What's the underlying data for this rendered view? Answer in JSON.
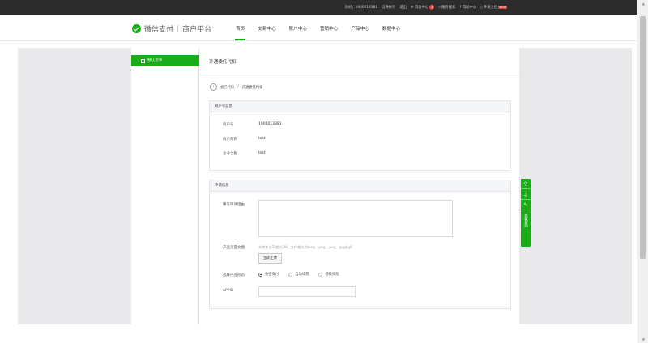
{
  "topbar": {
    "greeting": "你好，1900013381",
    "switch_account": "切换帐号",
    "logout": "退出",
    "message_center": "消息中心",
    "message_count": "2",
    "service_search": "服务搜索",
    "help_center": "帮助中心",
    "dev_docs": "开发文档",
    "new_tag": "NEW"
  },
  "header": {
    "logo_text": "微信支付",
    "platform_text": "商户平台",
    "nav": [
      "首页",
      "交易中心",
      "账户中心",
      "营销中心",
      "产品中心",
      "数据中心"
    ],
    "active_index": 0
  },
  "sidebar": {
    "active_item": "默认菜单"
  },
  "content": {
    "title": "开通委托代扣",
    "breadcrumb_parent": "委托代扣",
    "breadcrumb_sep": "/",
    "breadcrumb_current": "开通委托代扣"
  },
  "merchant_section": {
    "header": "商户号信息",
    "fields": [
      {
        "label": "商户号",
        "value": "1900013381"
      },
      {
        "label": "商户简称",
        "value": "test"
      },
      {
        "label": "企业全称",
        "value": "test"
      }
    ]
  },
  "apply_section": {
    "header": "申请信息",
    "reason_label": "填写申请理由",
    "screenshot_label": "产品页面文图",
    "upload_hint": "文件大小不超过2M，文件格式为bmp、png、jpeg、jpg或gif",
    "upload_button": "立即上传",
    "product_type_label": "选择产品形态",
    "product_types": [
      "免密支付",
      "自动续费",
      "授权扣款"
    ],
    "selected_product_type": "免密支付",
    "appid_label": "APPID",
    "appid_value": ""
  },
  "float_bar": {
    "icons": [
      "link-icon",
      "bell-icon",
      "edit-icon"
    ],
    "label": "获取帮助"
  }
}
